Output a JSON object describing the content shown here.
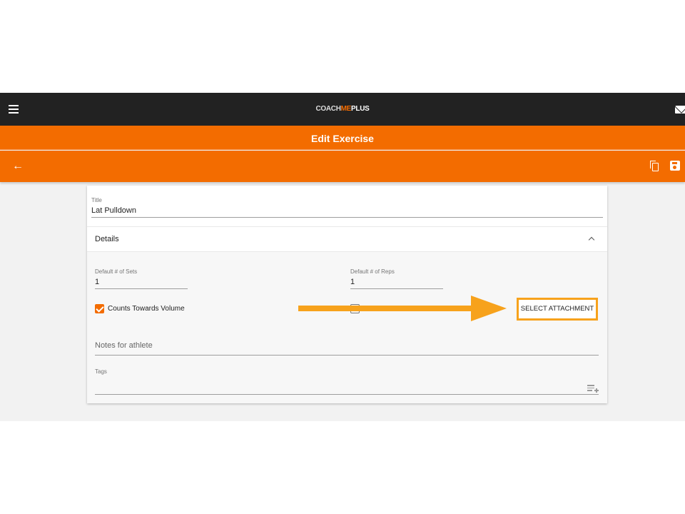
{
  "header": {
    "logo": {
      "coach": "COACH",
      "me": "ME",
      "plus": "PLUS"
    },
    "icons": {
      "menu": "menu-icon",
      "mail": "mail-icon"
    }
  },
  "title_bar": {
    "title": "Edit Exercise"
  },
  "action_bar": {
    "icons": {
      "back": "arrow-left-icon",
      "copy": "copy-icon",
      "save": "save-icon"
    }
  },
  "form": {
    "title": {
      "label": "Title",
      "value": "Lat Pulldown"
    },
    "details": {
      "header": "Details",
      "expanded": true,
      "sets": {
        "label": "Default # of Sets",
        "value": "1"
      },
      "reps": {
        "label": "Default # of Reps",
        "value": "1"
      },
      "counts_towards_volume": {
        "label": "Counts Towards Volume",
        "checked": true
      },
      "second_checkbox": {
        "checked": false
      },
      "attachment_button": "SELECT ATTACHMENT",
      "notes": {
        "placeholder": "Notes for athlete",
        "value": ""
      },
      "tags": {
        "label": "Tags",
        "value": ""
      }
    }
  },
  "annotation": {
    "highlight_color": "#f7a21c",
    "points_to": "SELECT ATTACHMENT"
  },
  "colors": {
    "brand_orange": "#f36c00",
    "topbar": "#222222",
    "annotation": "#f7a21c"
  }
}
